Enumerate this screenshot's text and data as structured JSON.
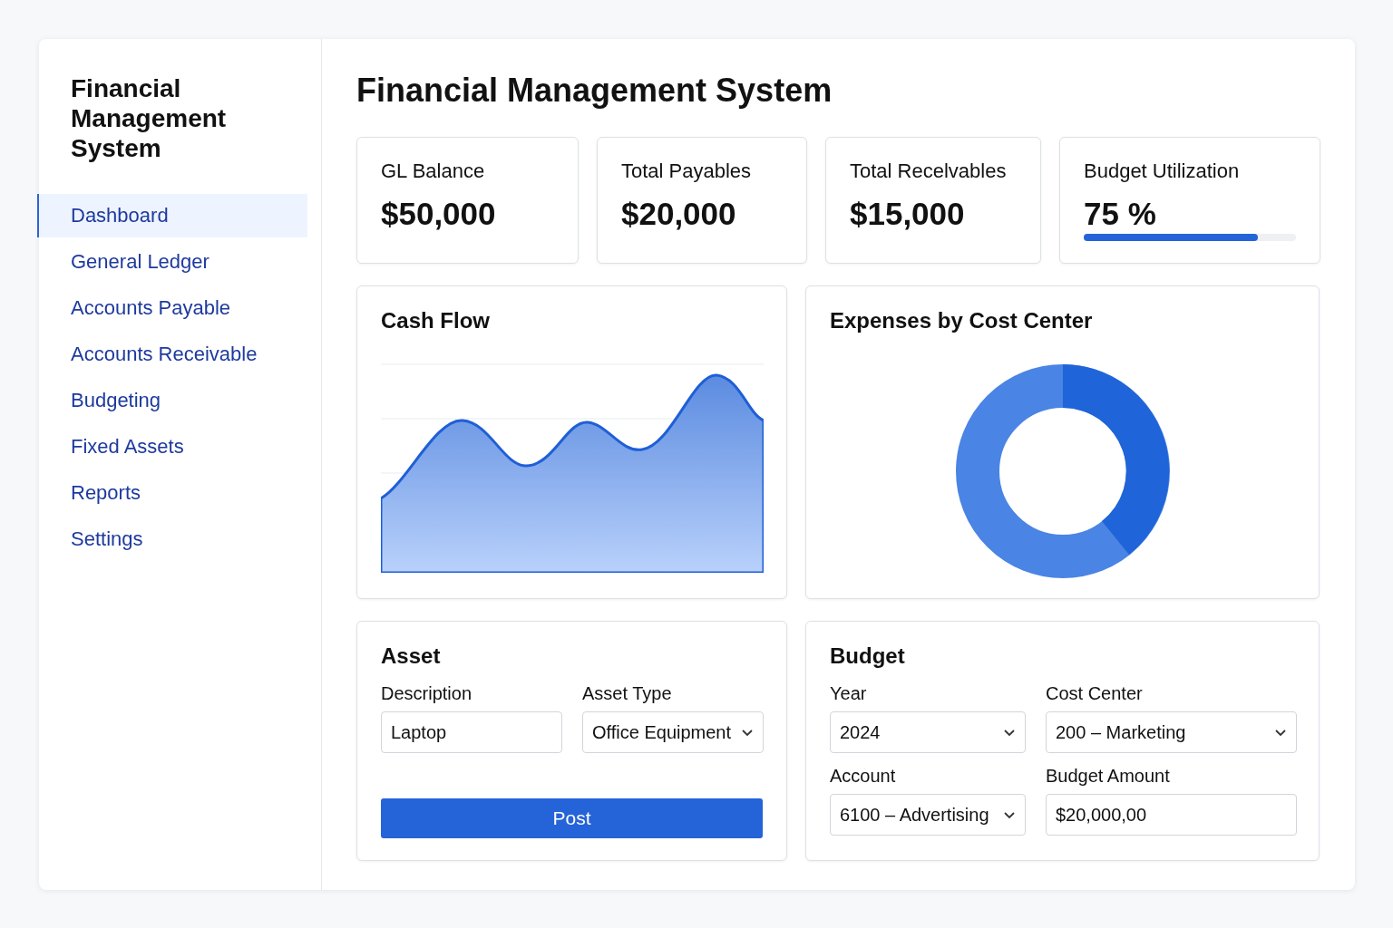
{
  "sidebar": {
    "title": "Financial Management System",
    "items": [
      {
        "label": "Dashboard",
        "selected": true
      },
      {
        "label": "General Ledger",
        "selected": false
      },
      {
        "label": "Accounts Payable",
        "selected": false
      },
      {
        "label": "Accounts Receivable",
        "selected": false
      },
      {
        "label": "Budgeting",
        "selected": false
      },
      {
        "label": "Fixed Assets",
        "selected": false
      },
      {
        "label": "Reports",
        "selected": false
      },
      {
        "label": "Settings",
        "selected": false
      }
    ]
  },
  "page_title": "Financial Management System",
  "stats": [
    {
      "kind": "value",
      "label": "GL Balance",
      "value": "$50,000"
    },
    {
      "kind": "value",
      "label": "Total Payables",
      "value": "$20,000"
    },
    {
      "kind": "value",
      "label": "Total Recelvables",
      "value": "$15,000"
    },
    {
      "kind": "meter",
      "label": "Budget Utilization",
      "value": "75 %",
      "level": 0.82
    }
  ],
  "cash_flow": {
    "title": "Cash Flow"
  },
  "expenses": {
    "title": "Expenses by Cost Center"
  },
  "asset": {
    "title": "Asset",
    "fields": [
      {
        "kind": "input",
        "label": "Description",
        "value": "Laptop"
      },
      {
        "kind": "select",
        "label": "Asset Type",
        "value": "Office Equipment"
      }
    ],
    "button": "Post"
  },
  "budget": {
    "title": "Budget",
    "fields": [
      {
        "kind": "select",
        "label": "Year",
        "value": "2024"
      },
      {
        "kind": "select",
        "label": "Cost Center",
        "value": "200 – Marketing"
      },
      {
        "kind": "select",
        "label": "Account",
        "value": "6100 – Advertising"
      },
      {
        "kind": "input",
        "label": "Budget Amount",
        "value": "$20,000,00"
      }
    ]
  }
}
